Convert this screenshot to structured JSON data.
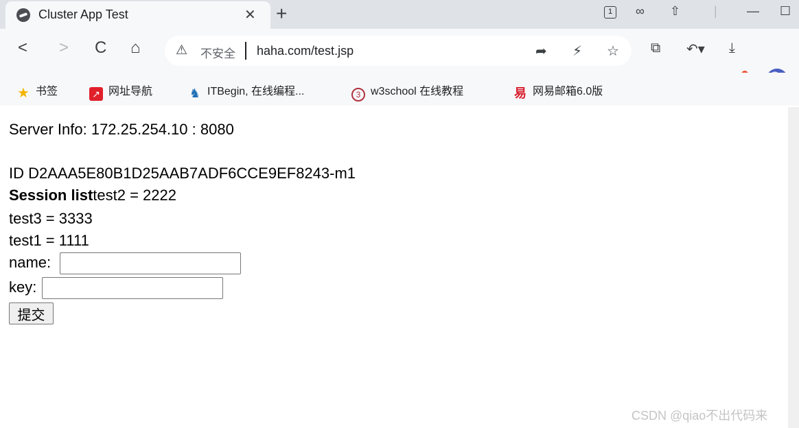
{
  "tab": {
    "title": "Cluster App Test",
    "count": "1"
  },
  "toolbar": {
    "insecure_label": "不安全",
    "url": "haha.com/test.jsp"
  },
  "bookmarks": [
    {
      "label": "书签",
      "icon": "star-icon",
      "color": "#f5b400"
    },
    {
      "label": "网址导航",
      "icon": "navigation-icon",
      "color": "#e0202a"
    },
    {
      "label": "ITBegin, 在线编程...",
      "icon": "itbegin-icon",
      "color": "#1e6fb5"
    },
    {
      "label": "w3school 在线教程",
      "icon": "w3school-icon",
      "color": "#b0313d"
    },
    {
      "label": "网易邮箱6.0版",
      "icon": "netease-mail-icon",
      "color": "#d81e2c"
    }
  ],
  "page": {
    "server_info": "Server Info: 172.25.254.10 : 8080",
    "session_id": "ID D2AAA5E80B1D25AAB7ADF6CCE9EF8243-m1",
    "session_list_label": "Session list",
    "session_items": [
      "test2 = 2222",
      "test3 = 3333",
      "test1 = 1111"
    ],
    "name_label": "name:",
    "name_value": "",
    "key_label": "key:",
    "key_value": "",
    "submit_label": "提交"
  },
  "watermark": "CSDN @qiao不出代码来"
}
